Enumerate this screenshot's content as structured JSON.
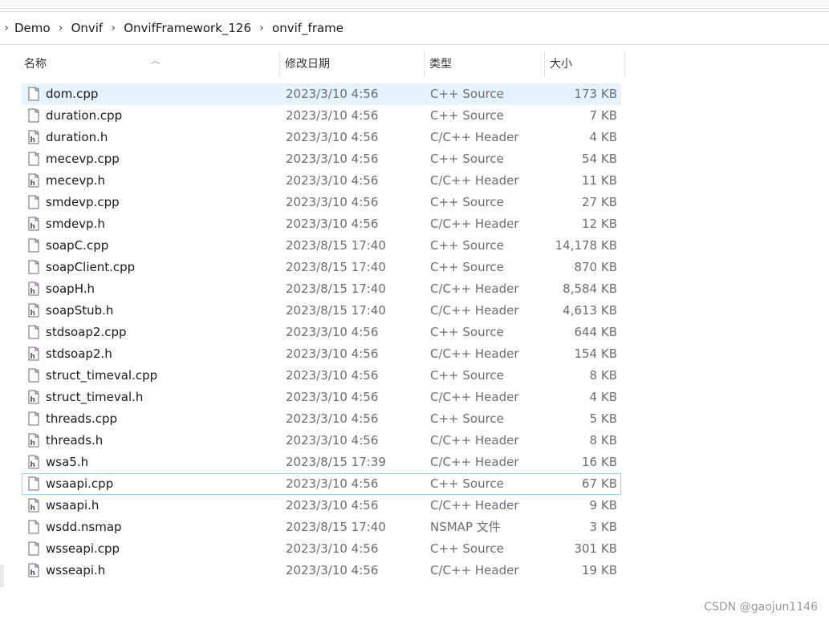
{
  "breadcrumb": {
    "items": [
      "Demo",
      "Onvif",
      "OnvifFramework_126",
      "onvif_frame"
    ]
  },
  "columns": {
    "name": "名称",
    "date": "修改日期",
    "type": "类型",
    "size": "大小"
  },
  "files": [
    {
      "name": "dom.cpp",
      "date": "2023/3/10 4:56",
      "type": "C++ Source",
      "size": "173 KB",
      "icon": "cpp-file-icon"
    },
    {
      "name": "duration.cpp",
      "date": "2023/3/10 4:56",
      "type": "C++ Source",
      "size": "7 KB",
      "icon": "cpp-file-icon"
    },
    {
      "name": "duration.h",
      "date": "2023/3/10 4:56",
      "type": "C/C++ Header",
      "size": "4 KB",
      "icon": "header-file-icon"
    },
    {
      "name": "mecevp.cpp",
      "date": "2023/3/10 4:56",
      "type": "C++ Source",
      "size": "54 KB",
      "icon": "cpp-file-icon"
    },
    {
      "name": "mecevp.h",
      "date": "2023/3/10 4:56",
      "type": "C/C++ Header",
      "size": "11 KB",
      "icon": "header-file-icon"
    },
    {
      "name": "smdevp.cpp",
      "date": "2023/3/10 4:56",
      "type": "C++ Source",
      "size": "27 KB",
      "icon": "cpp-file-icon"
    },
    {
      "name": "smdevp.h",
      "date": "2023/3/10 4:56",
      "type": "C/C++ Header",
      "size": "12 KB",
      "icon": "header-file-icon"
    },
    {
      "name": "soapC.cpp",
      "date": "2023/8/15 17:40",
      "type": "C++ Source",
      "size": "14,178 KB",
      "icon": "cpp-file-icon"
    },
    {
      "name": "soapClient.cpp",
      "date": "2023/8/15 17:40",
      "type": "C++ Source",
      "size": "870 KB",
      "icon": "cpp-file-icon"
    },
    {
      "name": "soapH.h",
      "date": "2023/8/15 17:40",
      "type": "C/C++ Header",
      "size": "8,584 KB",
      "icon": "header-file-icon"
    },
    {
      "name": "soapStub.h",
      "date": "2023/8/15 17:40",
      "type": "C/C++ Header",
      "size": "4,613 KB",
      "icon": "header-file-icon"
    },
    {
      "name": "stdsoap2.cpp",
      "date": "2023/3/10 4:56",
      "type": "C++ Source",
      "size": "644 KB",
      "icon": "cpp-file-icon"
    },
    {
      "name": "stdsoap2.h",
      "date": "2023/3/10 4:56",
      "type": "C/C++ Header",
      "size": "154 KB",
      "icon": "header-file-icon"
    },
    {
      "name": "struct_timeval.cpp",
      "date": "2023/3/10 4:56",
      "type": "C++ Source",
      "size": "8 KB",
      "icon": "cpp-file-icon"
    },
    {
      "name": "struct_timeval.h",
      "date": "2023/3/10 4:56",
      "type": "C/C++ Header",
      "size": "4 KB",
      "icon": "header-file-icon"
    },
    {
      "name": "threads.cpp",
      "date": "2023/3/10 4:56",
      "type": "C++ Source",
      "size": "5 KB",
      "icon": "cpp-file-icon"
    },
    {
      "name": "threads.h",
      "date": "2023/3/10 4:56",
      "type": "C/C++ Header",
      "size": "8 KB",
      "icon": "header-file-icon"
    },
    {
      "name": "wsa5.h",
      "date": "2023/8/15 17:39",
      "type": "C/C++ Header",
      "size": "16 KB",
      "icon": "header-file-icon"
    },
    {
      "name": "wsaapi.cpp",
      "date": "2023/3/10 4:56",
      "type": "C++ Source",
      "size": "67 KB",
      "icon": "cpp-file-icon"
    },
    {
      "name": "wsaapi.h",
      "date": "2023/3/10 4:56",
      "type": "C/C++ Header",
      "size": "9 KB",
      "icon": "header-file-icon"
    },
    {
      "name": "wsdd.nsmap",
      "date": "2023/8/15 17:40",
      "type": "NSMAP 文件",
      "size": "3 KB",
      "icon": "blank-file-icon"
    },
    {
      "name": "wsseapi.cpp",
      "date": "2023/3/10 4:56",
      "type": "C++ Source",
      "size": "301 KB",
      "icon": "cpp-file-icon"
    },
    {
      "name": "wsseapi.h",
      "date": "2023/3/10 4:56",
      "type": "C/C++ Header",
      "size": "19 KB",
      "icon": "header-file-icon"
    }
  ],
  "selected_index": 0,
  "focused_index": 18,
  "watermark": "CSDN @gaojun1146",
  "colors": {
    "selection": "#e5f3ff",
    "focus_border": "#99d1ff",
    "icon_accent": "#8b4fb5"
  }
}
